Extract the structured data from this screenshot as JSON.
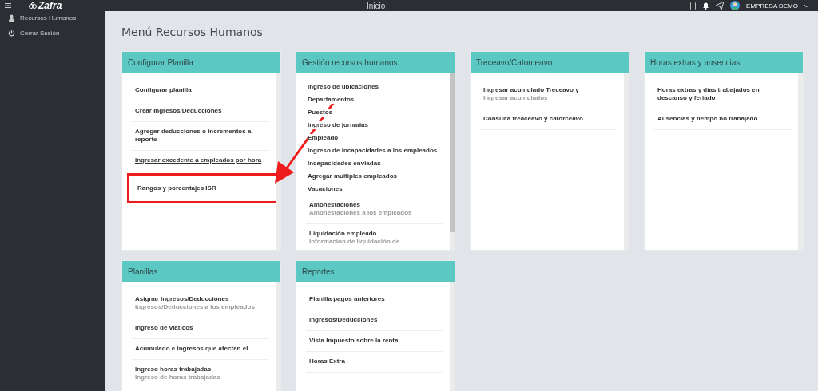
{
  "topbar": {
    "logo": "Zafra",
    "title": "Inicio",
    "company": "EMPRESA DEMO"
  },
  "sidebar": {
    "items": [
      {
        "label": "Recursos Humanos",
        "kind": "user"
      },
      {
        "label": "Cerrar Sesión",
        "kind": "power"
      }
    ]
  },
  "page_title": "Menú Recursos Humanos",
  "rows": [
    [
      {
        "title": "Configurar Planilla",
        "scroll_thumb": false,
        "items": [
          {
            "kind": "entry",
            "title": "Configurar planilla"
          },
          {
            "kind": "entry",
            "title": "Crear Ingresos/Deducciones"
          },
          {
            "kind": "entry",
            "title": "Agregar deducciones o incrementos a reporte"
          },
          {
            "kind": "plain",
            "title": "Ingresar excedente a empleados por hora",
            "underlined": true
          },
          {
            "kind": "plain",
            "title": "Rangos y porcentajes ISR",
            "highlighted": true
          }
        ]
      },
      {
        "title": "Gestión recursos humanos",
        "scroll_thumb": true,
        "items": [
          {
            "kind": "compact",
            "title": "Ingreso de ubicaciones"
          },
          {
            "kind": "compact",
            "title": "Departamentos"
          },
          {
            "kind": "compact",
            "title": "Puestos"
          },
          {
            "kind": "compact",
            "title": "Ingreso de jornadas"
          },
          {
            "kind": "compact",
            "title": "Empleado"
          },
          {
            "kind": "compact",
            "title": "Ingreso de incapacidades a los empleados"
          },
          {
            "kind": "compact",
            "title": "Incapacidades enviadas"
          },
          {
            "kind": "compact",
            "title": "Agregar multiples empleados"
          },
          {
            "kind": "compact",
            "title": "Vacaciones"
          },
          {
            "kind": "entry",
            "title": "Amonestaciones",
            "subtitle": "Amonestaciones a los empleados"
          },
          {
            "kind": "plain",
            "title": "Liquidación empleado",
            "subtitle": "Información de liquidación de"
          }
        ]
      },
      {
        "title": "Treceavo/Catorceavo",
        "scroll_thumb": false,
        "items": [
          {
            "kind": "entry",
            "title": "Ingresar acumulado Treceavo y",
            "subtitle": "Ingresar acumulados"
          },
          {
            "kind": "entry",
            "title": "Consulta treaceavo y catorceavo"
          }
        ]
      },
      {
        "title": "Horas extras y ausencias",
        "scroll_thumb": false,
        "items": [
          {
            "kind": "entry",
            "title": "Horas extras y días trabajados en descanso y feriado"
          },
          {
            "kind": "entry",
            "title": "Ausencias y tiempo no trabajado"
          }
        ]
      }
    ],
    [
      {
        "title": "Planillas",
        "scroll_thumb": false,
        "items": [
          {
            "kind": "entry",
            "title": "Asignar Ingresos/Deducciones",
            "subtitle": "Ingresos/Deducciones a los empleados"
          },
          {
            "kind": "entry",
            "title": "Ingreso de viáticos"
          },
          {
            "kind": "entry",
            "title": "Acumulado e ingresos que afectan el"
          },
          {
            "kind": "plain",
            "title": "Ingreso horas trabajadas",
            "subtitle": "Ingreso de horas trabajadas"
          }
        ]
      },
      {
        "title": "Reportes",
        "scroll_thumb": false,
        "items": [
          {
            "kind": "entry",
            "title": "Planilla pagos anteriores"
          },
          {
            "kind": "entry",
            "title": "Ingresos/Deducciones"
          },
          {
            "kind": "entry",
            "title": "Vista Impuesto sobre la renta"
          },
          {
            "kind": "entry",
            "title": "Horas Extra"
          }
        ]
      }
    ]
  ]
}
